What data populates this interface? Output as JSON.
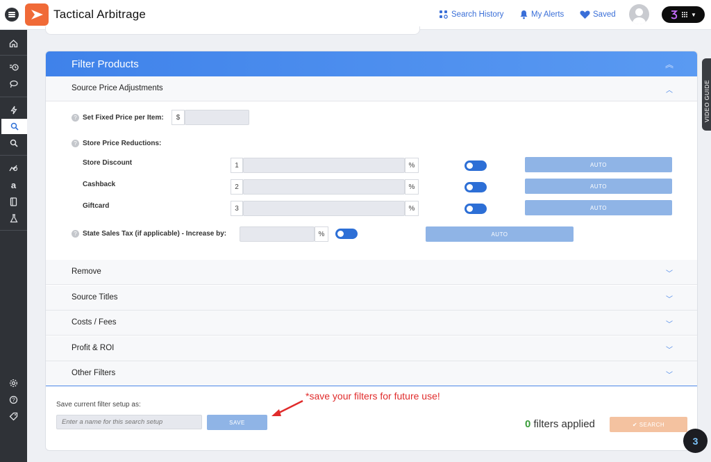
{
  "app": {
    "title": "Tactical Arbitrage"
  },
  "topnav": {
    "search_history": "Search History",
    "my_alerts": "My Alerts",
    "saved": "Saved"
  },
  "video_guide": "VIDEO GUIDE",
  "panel": {
    "title": "Filter Products"
  },
  "source_price": {
    "title": "Source Price Adjustments",
    "fixed_price_label": "Set Fixed Price per Item:",
    "currency": "$",
    "reductions_label": "Store Price Reductions:",
    "rows": [
      {
        "label": "Store Discount",
        "num": "1",
        "unit": "%",
        "auto": "AUTO"
      },
      {
        "label": "Cashback",
        "num": "2",
        "unit": "%",
        "auto": "AUTO"
      },
      {
        "label": "Giftcard",
        "num": "3",
        "unit": "%",
        "auto": "AUTO"
      }
    ],
    "tax_label": "State Sales Tax (if applicable) - Increase by:",
    "tax_unit": "%",
    "tax_auto": "AUTO"
  },
  "sections": [
    {
      "label": "Remove"
    },
    {
      "label": "Source Titles"
    },
    {
      "label": "Costs / Fees"
    },
    {
      "label": "Profit & ROI"
    },
    {
      "label": "Other Filters"
    }
  ],
  "footer": {
    "save_label": "Save current filter setup as:",
    "name_placeholder": "Enter a name for this search setup",
    "save_button": "SAVE",
    "annotation": "*save your filters for future use!",
    "filters_count": "0",
    "filters_text": "filters applied",
    "search_button": "✔ SEARCH"
  },
  "colors": {
    "accent": "#3f82ea",
    "sidebar": "#2f3237",
    "logo": "#f06a37",
    "annotation": "#e02b2b"
  }
}
